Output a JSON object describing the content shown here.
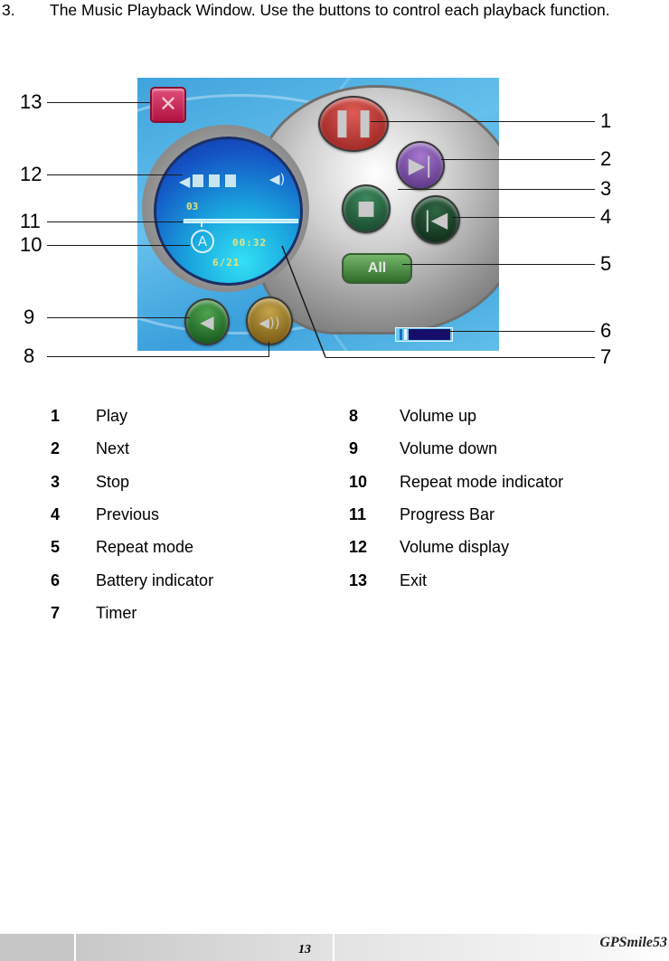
{
  "step": {
    "number": "3.",
    "text": "The Music Playback Window. Use the buttons to control each playback function."
  },
  "player": {
    "exit_glyph": "✕",
    "play_glyph": "❚❚",
    "next_glyph": "▶|",
    "stop_glyph": "■",
    "prev_glyph": "|◀",
    "repeat_label": "All",
    "vol_down_glyph": "◀",
    "vol_up_glyph": "◀))",
    "display": {
      "volume_left_glyph": "◀",
      "volume_level_blocks": 3,
      "speaker_glyph": "◀)",
      "track_number": "03",
      "repeat_indicator": "A",
      "timer": "00:32",
      "track_count": "6/21",
      "progress_fraction": 0.15
    },
    "battery_fraction": 0.8,
    "icons": {
      "exit": "close-icon",
      "play": "pause-icon",
      "next": "next-track-icon",
      "stop": "stop-icon",
      "prev": "previous-track-icon",
      "vol_down": "volume-down-icon",
      "vol_up": "volume-up-icon",
      "repeat_indicator": "repeat-a-icon",
      "battery": "battery-icon"
    }
  },
  "callouts": {
    "left": [
      "13",
      "12",
      "11",
      "10",
      "9",
      "8"
    ],
    "right": [
      "1",
      "2",
      "3",
      "4",
      "5",
      "6",
      "7"
    ]
  },
  "legend": {
    "left": [
      {
        "num": "1",
        "label": "Play"
      },
      {
        "num": "2",
        "label": "Next"
      },
      {
        "num": "3",
        "label": "Stop"
      },
      {
        "num": "4",
        "label": "Previous"
      },
      {
        "num": "5",
        "label": "Repeat mode"
      },
      {
        "num": "6",
        "label": "Battery indicator"
      },
      {
        "num": "7",
        "label": "Timer"
      }
    ],
    "right": [
      {
        "num": "8",
        "label": "Volume up"
      },
      {
        "num": "9",
        "label": "Volume down"
      },
      {
        "num": "10",
        "label": "Repeat mode indicator"
      },
      {
        "num": "11",
        "label": "Progress Bar"
      },
      {
        "num": "12",
        "label": "Volume display"
      },
      {
        "num": "13",
        "label": "Exit"
      }
    ]
  },
  "footer": {
    "page_number": "13",
    "brand": "GPSmile53"
  }
}
